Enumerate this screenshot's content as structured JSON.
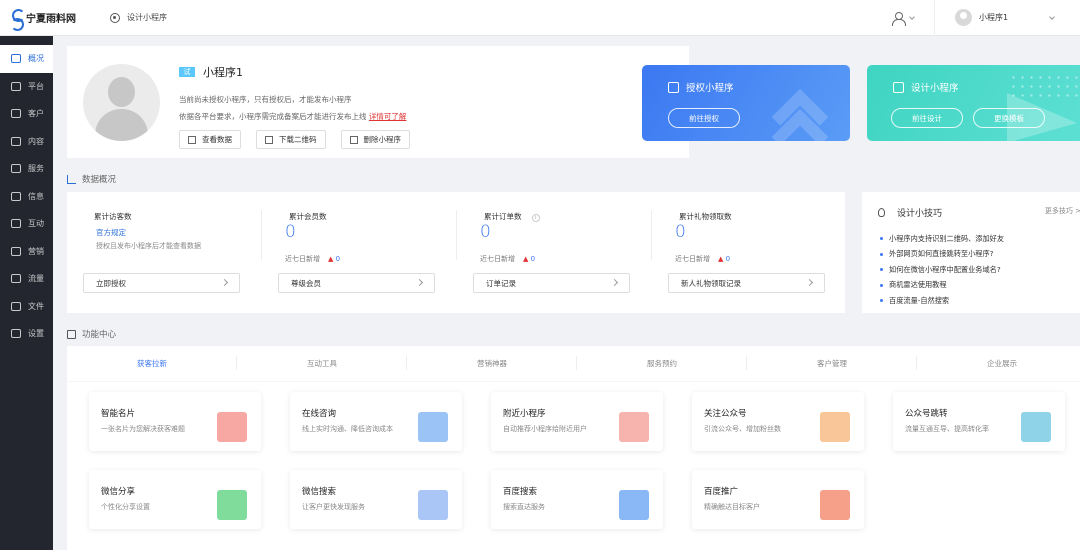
{
  "header": {
    "logo_text": "宁夏雨料网",
    "app_switch_label": "设计小程序",
    "account_name": "小程序1"
  },
  "sidebar": {
    "items": [
      {
        "label": "概况",
        "icon": "chart-icon",
        "active": true
      },
      {
        "label": "平台",
        "icon": "layers-icon"
      },
      {
        "label": "客户",
        "icon": "user-icon"
      },
      {
        "label": "内容",
        "icon": "document-icon"
      },
      {
        "label": "服务",
        "icon": "service-icon"
      },
      {
        "label": "信息",
        "icon": "message-icon"
      },
      {
        "label": "互动",
        "icon": "interact-icon"
      },
      {
        "label": "营销",
        "icon": "tag-icon"
      },
      {
        "label": "流量",
        "icon": "megaphone-icon"
      },
      {
        "label": "文件",
        "icon": "folder-icon"
      },
      {
        "label": "设置",
        "icon": "gear-icon"
      }
    ]
  },
  "profile": {
    "tag": "试",
    "name": "小程序1",
    "line1": "当前尚未授权小程序，只有授权后，才能发布小程序",
    "line2": "依据各平台要求，小程序需完成备案后才能进行发布上线",
    "line2_link": "详情可了解",
    "buttons": [
      "查看数据",
      "下载二维码",
      "删除小程序"
    ]
  },
  "cards": {
    "authorize": {
      "title": "授权小程序",
      "button": "前往授权",
      "color": "#3b78f2"
    },
    "design": {
      "title": "设计小程序",
      "buttons": [
        "前往设计",
        "更换模板"
      ],
      "color": "#3fd4c2"
    }
  },
  "data_overview": {
    "title": "数据概况",
    "stats": [
      {
        "label": "累计访客数",
        "link": "官方规定",
        "note": "授权且发布小程序后才能查看数据",
        "button": "立即授权"
      },
      {
        "label": "累计会员数",
        "value": "0",
        "week_label": "近七日新增",
        "week_value": "0",
        "button": "尊级会员"
      },
      {
        "label": "累计订单数",
        "value": "0",
        "week_label": "近七日新增",
        "week_value": "0",
        "button": "订单记录",
        "info": "i"
      },
      {
        "label": "累计礼物领取数",
        "value": "0",
        "week_label": "近七日新增",
        "week_value": "0",
        "button": "新人礼物领取记录"
      }
    ]
  },
  "tips": {
    "title": "设计小技巧",
    "more": "更多技巧 >",
    "items": [
      "小程序内支持识别二维码、添加好友",
      "外部网页如何直接跳转至小程序?",
      "如何在微信小程序中配置业务域名?",
      "商机雷达使用教程",
      "百度流量-自然搜索"
    ]
  },
  "function_center": {
    "title": "功能中心",
    "tabs": [
      "获客拉新",
      "互动工具",
      "营销神器",
      "服务预约",
      "客户管理",
      "企业展示"
    ],
    "cards": [
      {
        "title": "智能名片",
        "desc": "一张名片为您解决获客难题",
        "color": "#f7a8a3"
      },
      {
        "title": "在线咨询",
        "desc": "线上实时沟通、降低咨询成本",
        "color": "#9cc3f5"
      },
      {
        "title": "附近小程序",
        "desc": "自动推荐小程序给附近用户",
        "color": "#f7b3ad"
      },
      {
        "title": "关注公众号",
        "desc": "引流公众号、增加粉丝数",
        "color": "#f9c69a"
      },
      {
        "title": "公众号跳转",
        "desc": "流量互通互导、提高转化率",
        "color": "#8fd3e8"
      },
      {
        "title": "微信分享",
        "desc": "个性化分享设置",
        "color": "#7fdc9b"
      },
      {
        "title": "微信搜索",
        "desc": "让客户更快发现服务",
        "color": "#a9c6f7"
      },
      {
        "title": "百度搜索",
        "desc": "搜索直达服务",
        "color": "#8ab7f5"
      },
      {
        "title": "百度推广",
        "desc": "精确触达目标客户",
        "color": "#f6a08a"
      }
    ]
  }
}
